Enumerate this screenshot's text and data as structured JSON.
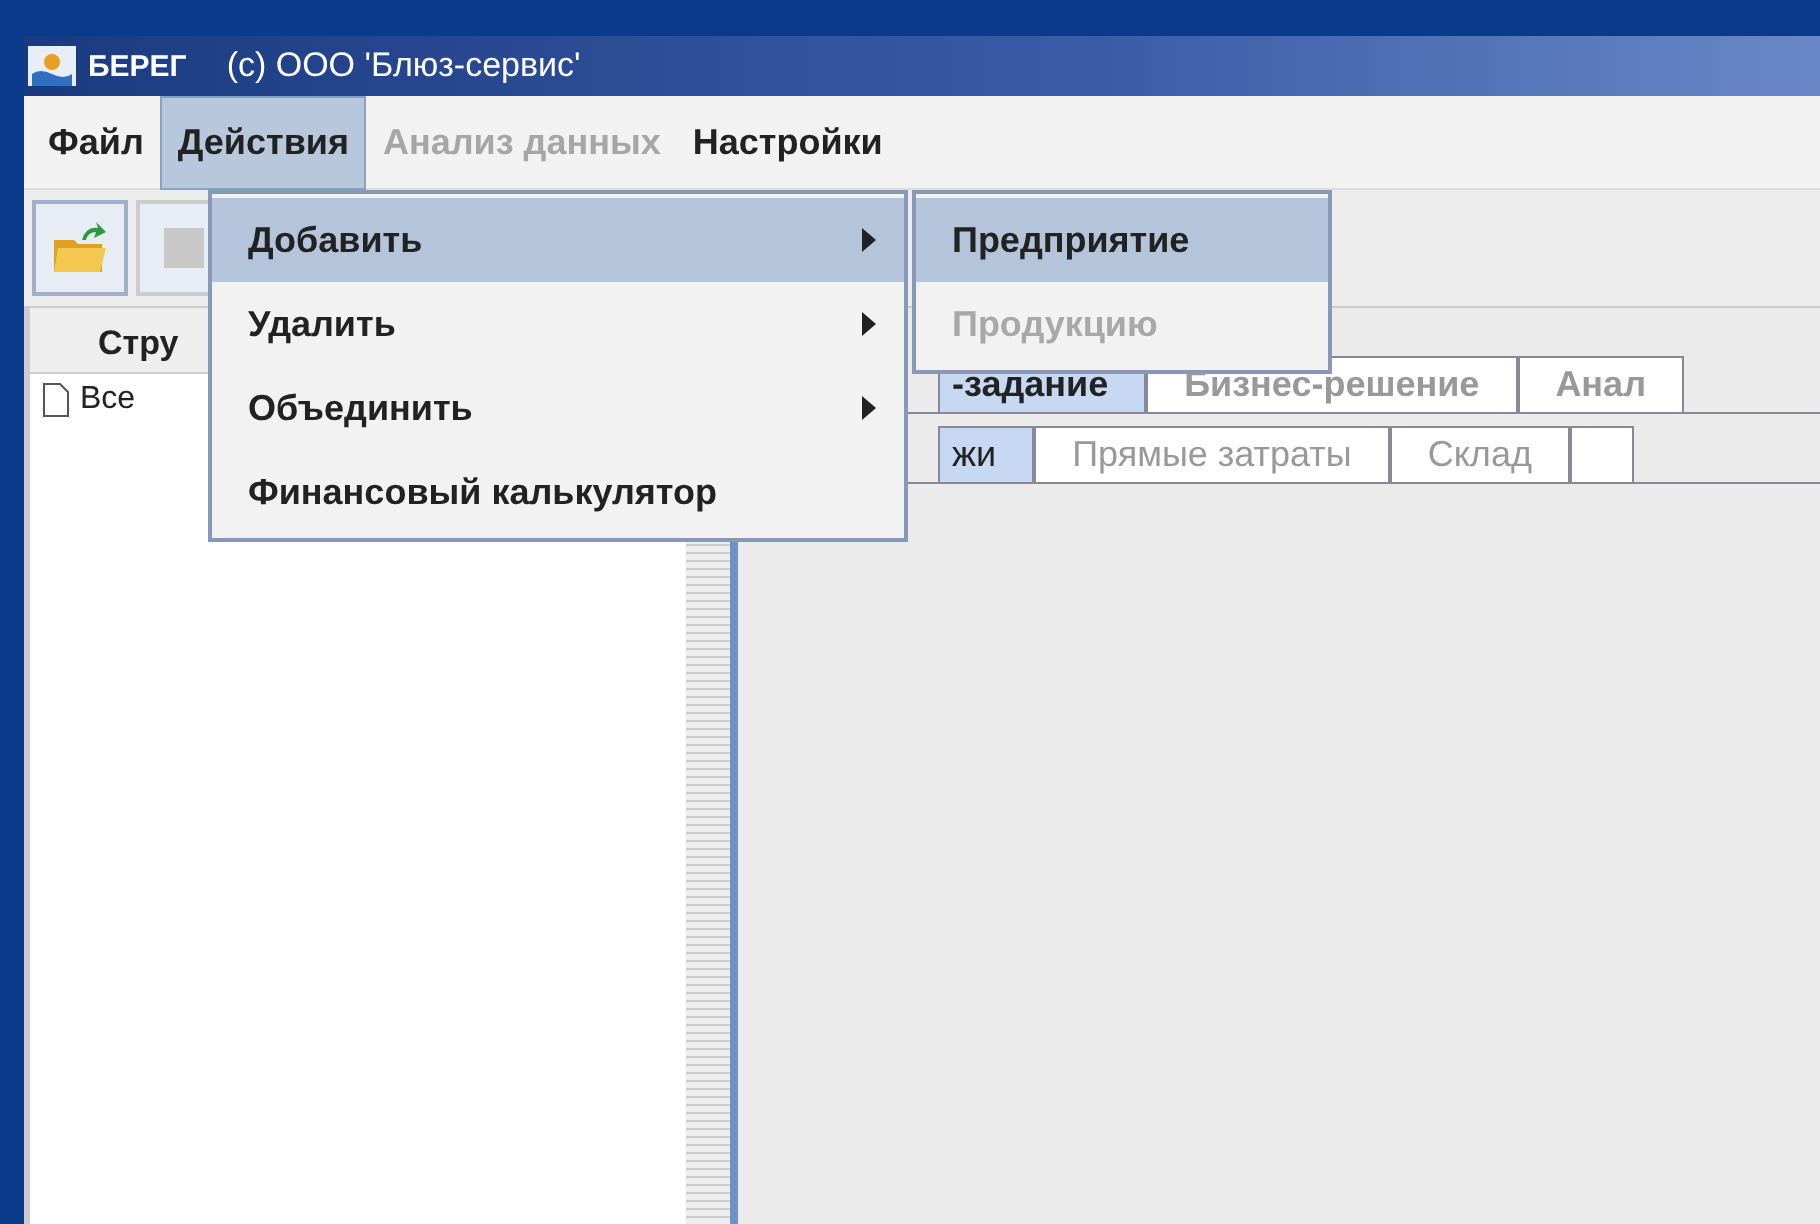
{
  "window": {
    "app_name": "БЕРЕГ",
    "title": "(c) ООО 'Блюз-сервис'"
  },
  "menu_bar": [
    {
      "label": "Файл",
      "selected": false,
      "disabled": false
    },
    {
      "label": "Действия",
      "selected": true,
      "disabled": false
    },
    {
      "label": "Анализ данных",
      "selected": false,
      "disabled": true
    },
    {
      "label": "Настройки",
      "selected": false,
      "disabled": false
    }
  ],
  "open_menu": [
    {
      "label": "Добавить",
      "selected": true,
      "submenu": true
    },
    {
      "label": "Удалить",
      "selected": false,
      "submenu": true
    },
    {
      "label": "Объединить",
      "selected": false,
      "submenu": true
    },
    {
      "label": "Финансовый калькулятор",
      "selected": false,
      "submenu": false
    }
  ],
  "submenu": [
    {
      "label": "Предприятие",
      "selected": true,
      "disabled": false
    },
    {
      "label": "Продукцию",
      "selected": false,
      "disabled": true
    }
  ],
  "left_panel": {
    "header": "Стру",
    "items": [
      {
        "label": "Все"
      }
    ]
  },
  "tabs": [
    {
      "label": "-задание",
      "selected": true
    },
    {
      "label": "Бизнес-решение",
      "selected": false
    },
    {
      "label": "Анал",
      "selected": false
    }
  ],
  "subtabs": [
    {
      "label": "жи",
      "selected": true
    },
    {
      "label": "Прямые затраты",
      "selected": false
    },
    {
      "label": "Склад",
      "selected": false
    }
  ]
}
